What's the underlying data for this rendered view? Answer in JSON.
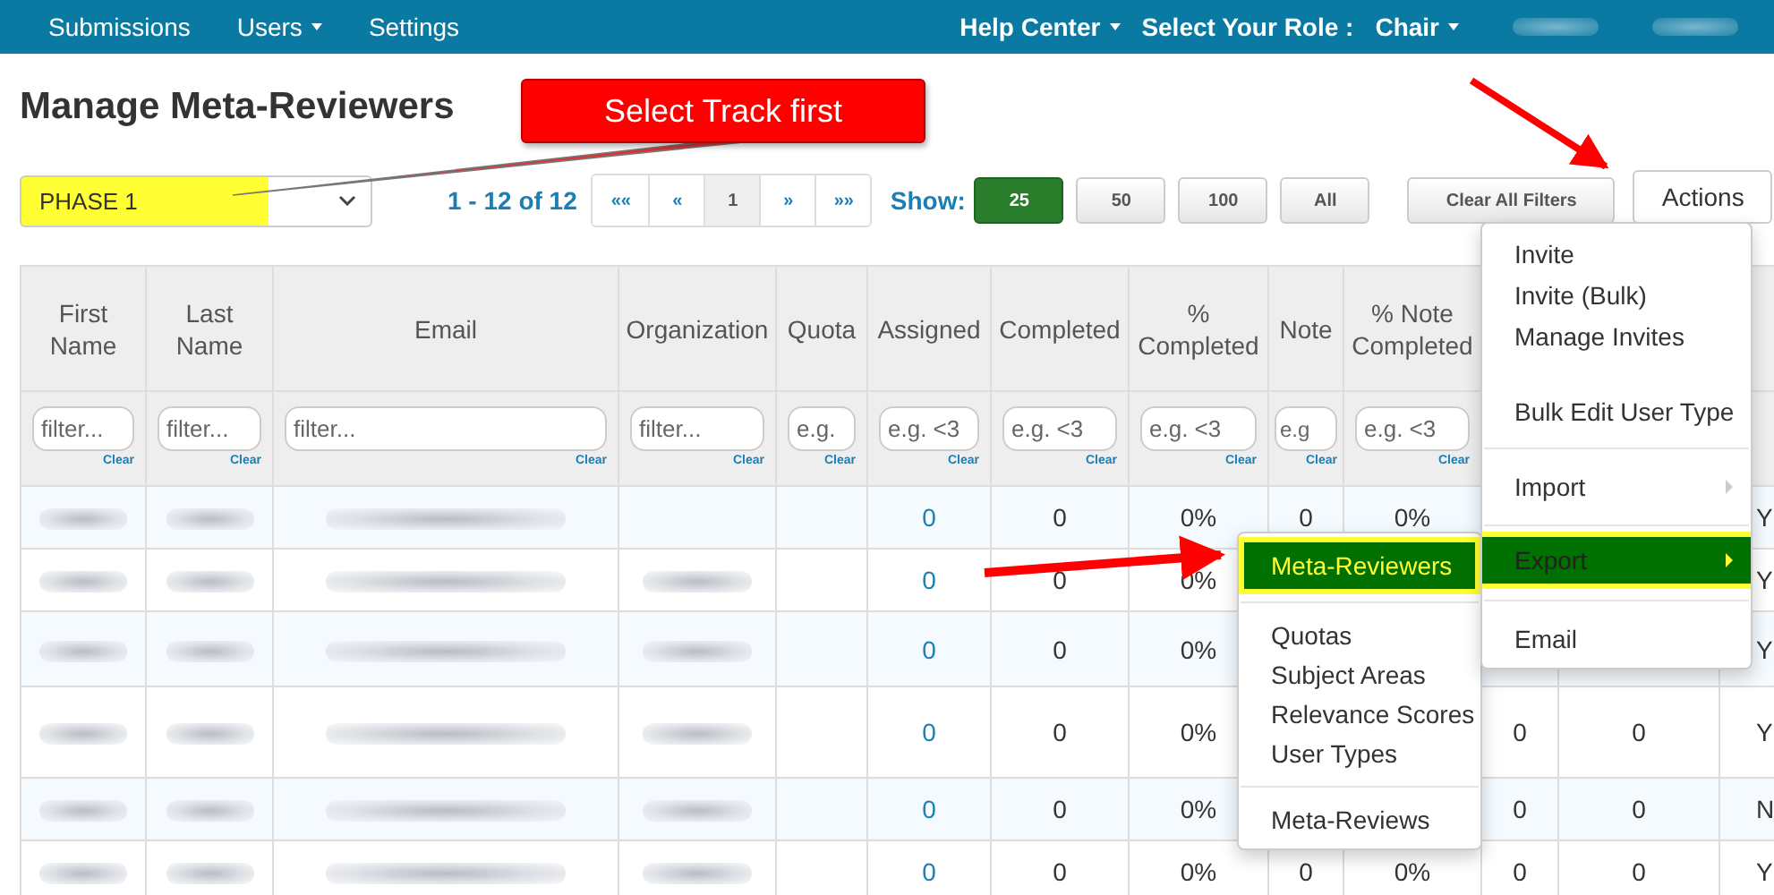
{
  "navbar": {
    "left_items": [
      {
        "kind": "link",
        "label": "Submissions",
        "has_menu": false
      },
      {
        "kind": "link",
        "label": "Users",
        "has_menu": true
      },
      {
        "kind": "link",
        "label": "Settings",
        "has_menu": false
      }
    ],
    "right_items": [
      {
        "kind": "link",
        "label": "Help Center",
        "has_menu": true
      },
      {
        "kind": "label",
        "label": "Select Your Role :"
      },
      {
        "kind": "link",
        "label": "Chair",
        "has_menu": true
      },
      {
        "kind": "blurred"
      },
      {
        "kind": "blurred"
      }
    ]
  },
  "page_title": "Manage Meta-Reviewers",
  "callout": {
    "text": "Select Track first"
  },
  "track_select": {
    "value": "PHASE 1",
    "highlighted": true
  },
  "pagination": {
    "range": "1 - 12 of 12",
    "buttons": [
      {
        "label": "««",
        "selected": false
      },
      {
        "label": "«",
        "selected": false
      },
      {
        "label": "1",
        "selected": true
      },
      {
        "label": "»",
        "selected": false
      },
      {
        "label": "»»",
        "selected": false
      }
    ]
  },
  "page_size": {
    "label": "Show:",
    "options": [
      {
        "label": "25",
        "selected": true
      },
      {
        "label": "50",
        "selected": false
      },
      {
        "label": "100",
        "selected": false
      },
      {
        "label": "All",
        "selected": false
      }
    ]
  },
  "clear_filters": "Clear All Filters",
  "actions_button": "Actions",
  "table": {
    "columns": [
      {
        "label": "First Name",
        "placeholder": "filter...",
        "clear": "Clear"
      },
      {
        "label": "Last Name",
        "placeholder": "filter...",
        "clear": "Clear"
      },
      {
        "label": "Email",
        "placeholder": "filter...",
        "clear": "Clear"
      },
      {
        "label": "Organization",
        "placeholder": "filter...",
        "clear": "Clear"
      },
      {
        "label": "Quota",
        "placeholder": "e.g.",
        "clear": "Clear"
      },
      {
        "label": "Assigned",
        "placeholder": "e.g. <3",
        "clear": "Clear"
      },
      {
        "label": "Completed",
        "placeholder": "e.g. <3",
        "clear": "Clear"
      },
      {
        "label": "% Completed",
        "placeholder": "e.g. <3",
        "clear": "Clear"
      },
      {
        "label": "Note",
        "placeholder": "e.g",
        "clear": "Clear"
      },
      {
        "label": "% Note Completed",
        "placeholder": "e.g. <3",
        "clear": "Clear"
      },
      {},
      {},
      {}
    ],
    "rows": [
      {
        "cells": [
          {
            "kind": "blurred"
          },
          {
            "kind": "blurred"
          },
          {
            "kind": "blurred"
          },
          null,
          null,
          {
            "kind": "link",
            "text": "0"
          },
          "0",
          "0%",
          "0",
          "0%",
          null,
          null,
          "Y"
        ]
      },
      {
        "cells": [
          {
            "kind": "blurred"
          },
          {
            "kind": "blurred"
          },
          {
            "kind": "blurred"
          },
          {
            "kind": "blurred"
          },
          null,
          {
            "kind": "link",
            "text": "0"
          },
          "0",
          "0%",
          null,
          null,
          null,
          null,
          "Y"
        ]
      },
      {
        "cells": [
          {
            "kind": "blurred"
          },
          {
            "kind": "blurred"
          },
          {
            "kind": "blurred"
          },
          {
            "kind": "blurred"
          },
          null,
          {
            "kind": "link",
            "text": "0"
          },
          "0",
          "0%",
          null,
          null,
          null,
          null,
          "Y"
        ]
      },
      {
        "cells": [
          {
            "kind": "blurred"
          },
          {
            "kind": "blurred"
          },
          {
            "kind": "blurred"
          },
          {
            "kind": "blurred"
          },
          null,
          {
            "kind": "link",
            "text": "0"
          },
          "0",
          "0%",
          null,
          null,
          "0",
          "0",
          "Y"
        ]
      },
      {
        "cells": [
          {
            "kind": "blurred"
          },
          {
            "kind": "blurred"
          },
          {
            "kind": "blurred"
          },
          {
            "kind": "blurred"
          },
          null,
          {
            "kind": "link",
            "text": "0"
          },
          "0",
          "0%",
          null,
          null,
          "0",
          "0",
          "N"
        ]
      },
      {
        "cells": [
          {
            "kind": "blurred"
          },
          {
            "kind": "blurred"
          },
          {
            "kind": "blurred"
          },
          {
            "kind": "blurred"
          },
          null,
          {
            "kind": "link",
            "text": "0"
          },
          "0",
          "0%",
          "0",
          "0%",
          "0",
          "0",
          "Y"
        ]
      }
    ]
  },
  "actions_menu": {
    "items": [
      {
        "kind": "item",
        "label": "Invite",
        "selected": false
      },
      {
        "kind": "item",
        "label": "Invite (Bulk)",
        "selected": false
      },
      {
        "kind": "item",
        "label": "Manage Invites",
        "selected": false
      },
      {
        "kind": "spacer"
      },
      {
        "kind": "item",
        "label": "Bulk Edit User Type",
        "selected": false
      },
      {
        "kind": "divider"
      },
      {
        "kind": "submenu",
        "label": "Import",
        "selected": false
      },
      {
        "kind": "divider"
      },
      {
        "kind": "submenu",
        "label": "Export",
        "selected": true
      },
      {
        "kind": "divider"
      },
      {
        "kind": "item",
        "label": "Email",
        "selected": false
      }
    ]
  },
  "export_submenu": {
    "items": [
      {
        "kind": "item",
        "label": "Meta-Reviewers",
        "selected": true
      },
      {
        "kind": "divider"
      },
      {
        "kind": "item",
        "label": "Quotas",
        "selected": false
      },
      {
        "kind": "item",
        "label": "Subject Areas",
        "selected": false
      },
      {
        "kind": "item",
        "label": "Relevance Scores",
        "selected": false
      },
      {
        "kind": "item",
        "label": "User Types",
        "selected": false
      },
      {
        "kind": "divider"
      },
      {
        "kind": "item",
        "label": "Meta-Reviews",
        "selected": false
      }
    ]
  }
}
